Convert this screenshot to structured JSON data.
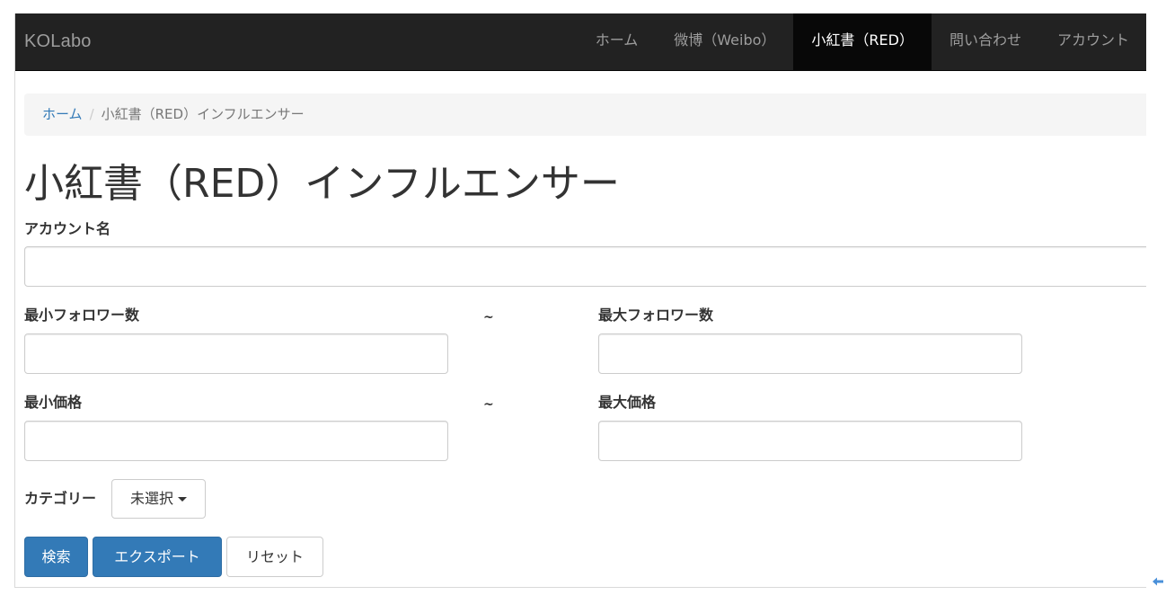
{
  "navbar": {
    "brand": "KOLabo",
    "items": [
      {
        "label": "ホーム",
        "active": false
      },
      {
        "label": "微博（Weibo）",
        "active": false
      },
      {
        "label": "小紅書（RED）",
        "active": true
      },
      {
        "label": "問い合わせ",
        "active": false
      },
      {
        "label": "アカウント",
        "active": false
      }
    ]
  },
  "breadcrumb": {
    "home": "ホーム",
    "separator": "/",
    "current": "小紅書（RED）インフルエンサー"
  },
  "page": {
    "title": "小紅書（RED）インフルエンサー"
  },
  "form": {
    "account_name_label": "アカウント名",
    "account_name_value": "",
    "min_followers_label": "最小フォロワー数",
    "min_followers_value": "",
    "max_followers_label": "最大フォロワー数",
    "max_followers_value": "",
    "min_price_label": "最小価格",
    "min_price_value": "",
    "max_price_label": "最大価格",
    "max_price_value": "",
    "range_separator": "~",
    "category_label": "カテゴリー",
    "category_selected": "未選択"
  },
  "buttons": {
    "search": "検索",
    "export": "エクスポート",
    "reset": "リセット"
  },
  "colors": {
    "navbar_bg": "#222222",
    "primary": "#337ab7",
    "link": "#337ab7"
  }
}
